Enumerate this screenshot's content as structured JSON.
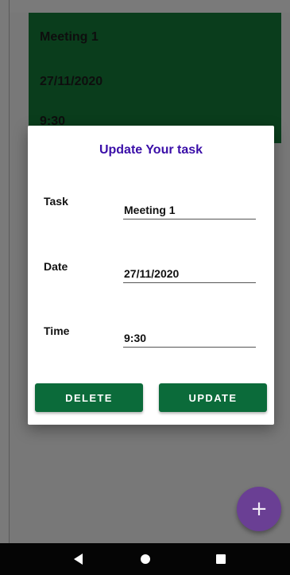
{
  "task_card": {
    "task": "Meeting 1",
    "date": "27/11/2020",
    "time": "9:30"
  },
  "dialog": {
    "title": "Update Your task",
    "fields": {
      "task_label": "Task",
      "task_value": "Meeting 1",
      "date_label": "Date",
      "date_value": "27/11/2020",
      "time_label": "Time",
      "time_value": "9:30"
    },
    "buttons": {
      "delete_label": "DELETE",
      "update_label": "UPDATE"
    }
  },
  "fab": {
    "icon": "plus-icon",
    "glyph": "+"
  },
  "navbar": {
    "back_icon": "back-triangle-icon",
    "home_icon": "home-circle-icon",
    "recents_icon": "recents-square-icon"
  },
  "colors": {
    "card_bg": "#0a3d1c",
    "dialog_title": "#3a0ea8",
    "button_bg": "#0b6b3a",
    "fab_bg": "#6a3f94"
  }
}
